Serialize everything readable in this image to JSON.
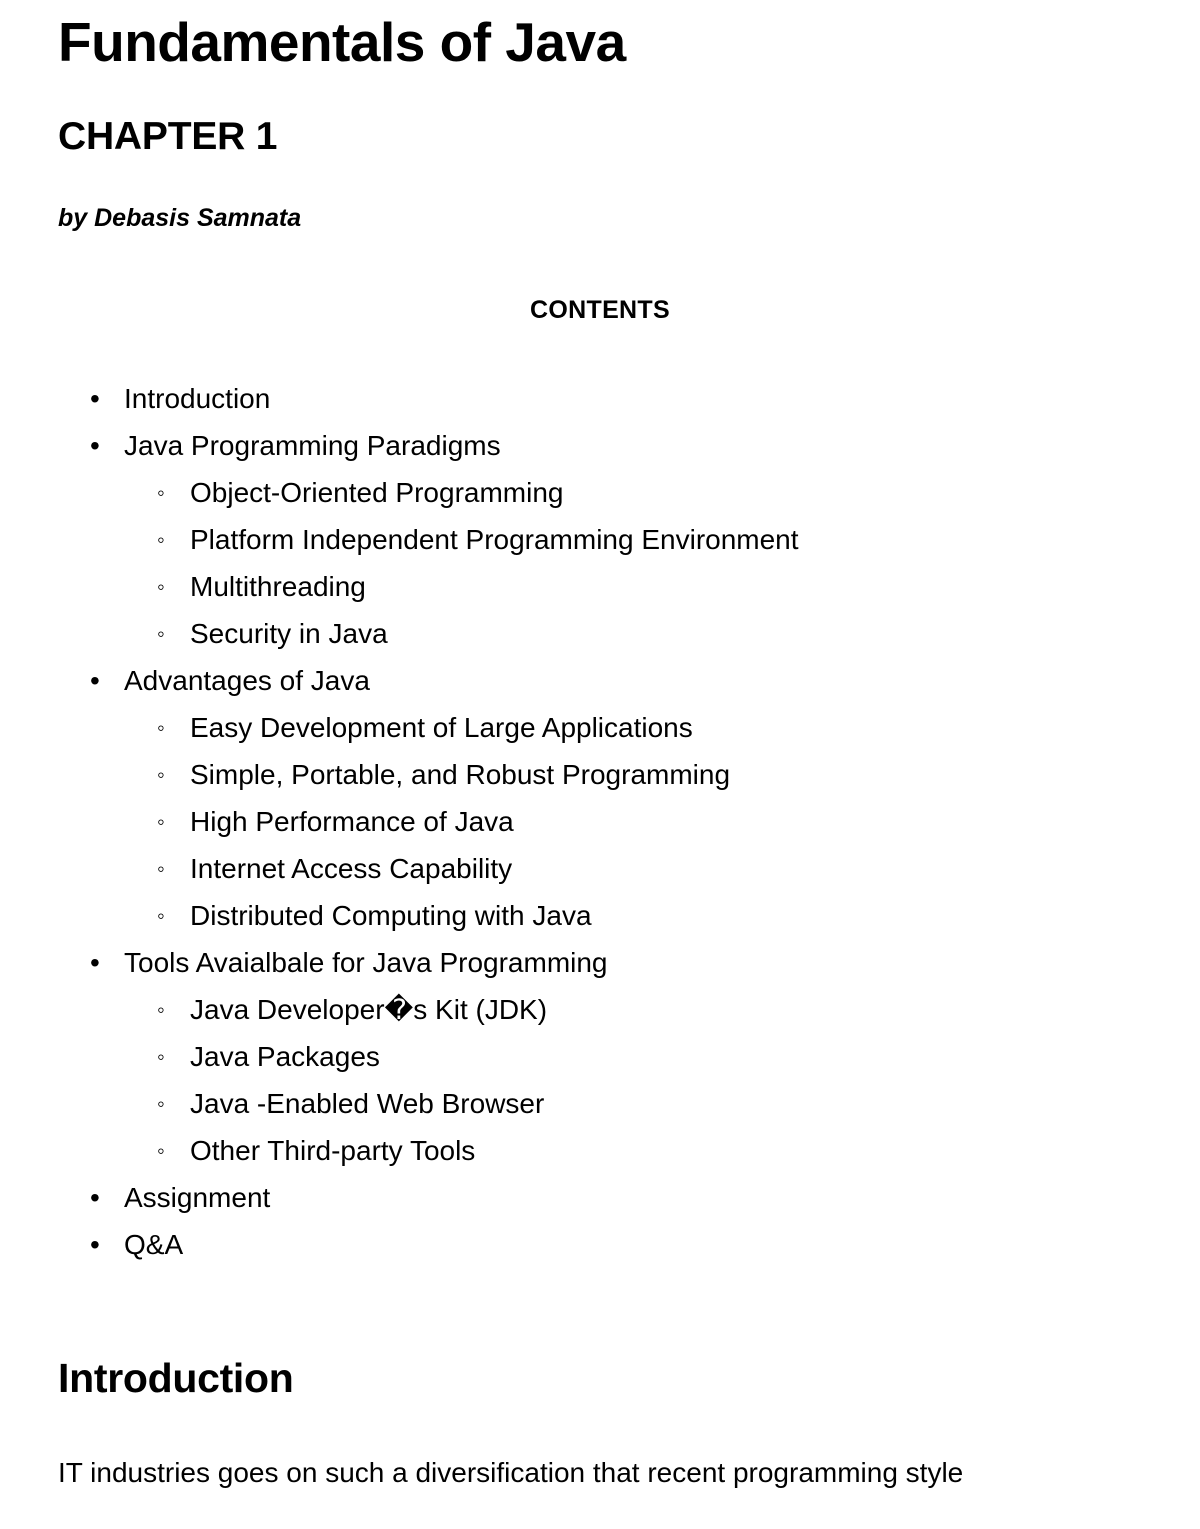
{
  "document": {
    "title": "Fundamentals of Java",
    "chapter": "CHAPTER 1",
    "byline": "by Debasis Samnata",
    "contents_heading": "CONTENTS"
  },
  "toc": {
    "items": [
      {
        "label": "Introduction",
        "children": []
      },
      {
        "label": "Java Programming Paradigms",
        "children": [
          {
            "label": "Object-Oriented Programming"
          },
          {
            "label": "Platform Independent Programming Environment"
          },
          {
            "label": "Multithreading"
          },
          {
            "label": "Security in Java"
          }
        ]
      },
      {
        "label": "Advantages of Java",
        "children": [
          {
            "label": "Easy Development of Large Applications"
          },
          {
            "label": "Simple, Portable, and Robust Programming"
          },
          {
            "label": "High Performance of Java"
          },
          {
            "label": "Internet Access Capability"
          },
          {
            "label": "Distributed Computing with Java"
          }
        ]
      },
      {
        "label": "Tools Avaialbale for Java Programming",
        "children": [
          {
            "label": "Java Developer�s Kit (JDK)"
          },
          {
            "label": "Java Packages"
          },
          {
            "label": "Java -Enabled Web Browser"
          },
          {
            "label": "Other Third-party Tools"
          }
        ]
      },
      {
        "label": "Assignment",
        "children": []
      },
      {
        "label": "Q&A",
        "children": []
      }
    ],
    "bullet_level_1": "•",
    "bullet_level_2": "◦"
  },
  "introduction": {
    "heading": "Introduction",
    "paragraph": "IT industries goes on such a diversification that recent programming style"
  },
  "colors": {
    "background": "#ffffff",
    "text": "#000000"
  }
}
